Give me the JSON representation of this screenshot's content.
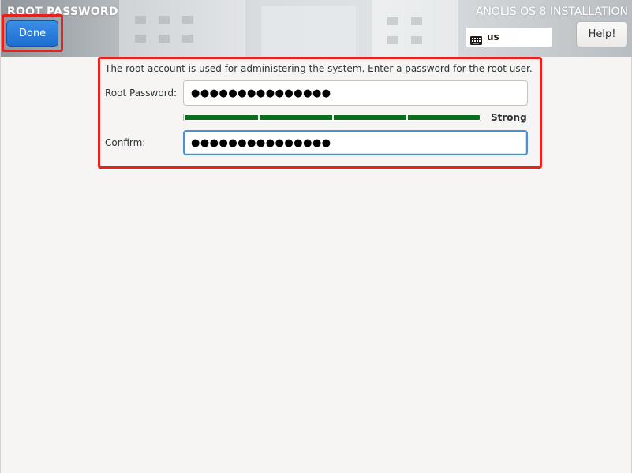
{
  "header": {
    "page_title": "ROOT PASSWORD",
    "install_title": "ANOLIS OS 8 INSTALLATION",
    "done_label": "Done",
    "help_label": "Help!",
    "keyboard_layout": "us"
  },
  "form": {
    "description": "The root account is used for administering the system.  Enter a password for the root user.",
    "root_password_label": "Root Password:",
    "root_password_value": "●●●●●●●●●●●●●●●",
    "confirm_label": "Confirm:",
    "confirm_value": "●●●●●●●●●●●●●●●",
    "strength_label": "Strength",
    "strength_text": "Strong",
    "strength_level": 1.0
  },
  "colors": {
    "accent_blue": "#1c6fd1",
    "strength_green": "#0b6e1b",
    "highlight_red": "#e8211f",
    "focus_blue": "#4a90d9"
  },
  "icons": {
    "keyboard": "keyboard-icon"
  }
}
